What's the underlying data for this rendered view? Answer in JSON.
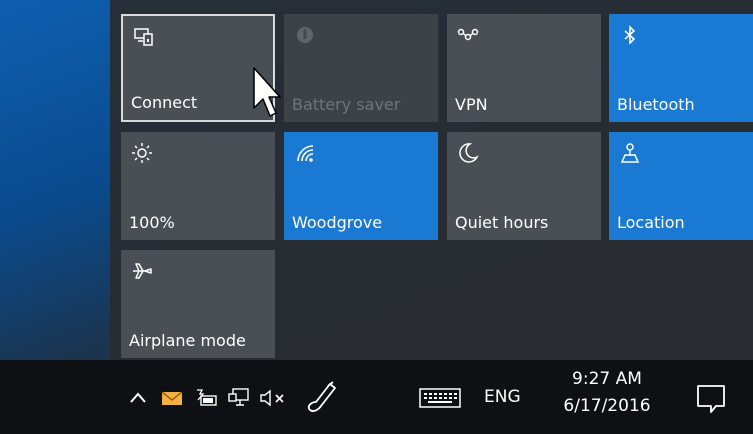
{
  "quick_actions": {
    "tiles": [
      {
        "label": "Connect",
        "icon": "connect-icon",
        "state": "focused"
      },
      {
        "label": "Battery saver",
        "icon": "battery-saver-icon",
        "state": "disabled"
      },
      {
        "label": "VPN",
        "icon": "vpn-icon",
        "state": "off"
      },
      {
        "label": "Bluetooth",
        "icon": "bluetooth-icon",
        "state": "on"
      },
      {
        "label": "100%",
        "icon": "brightness-icon",
        "state": "off"
      },
      {
        "label": "Woodgrove",
        "icon": "wifi-icon",
        "state": "on"
      },
      {
        "label": "Quiet hours",
        "icon": "moon-icon",
        "state": "off"
      },
      {
        "label": "Location",
        "icon": "location-icon",
        "state": "on"
      },
      {
        "label": "Airplane mode",
        "icon": "airplane-icon",
        "state": "off"
      }
    ]
  },
  "taskbar": {
    "language": "ENG",
    "time": "9:27 AM",
    "date": "6/17/2016",
    "tray_icons": [
      "chevron-up-icon",
      "mail-icon",
      "battery-icon",
      "network-icon",
      "volume-muted-icon",
      "pen-icon",
      "keyboard-icon"
    ],
    "action_center_icon": "notifications-icon"
  },
  "colors": {
    "accent": "#1979d3",
    "tile_off": "#4a4f55",
    "taskbar": "#0f1013"
  }
}
